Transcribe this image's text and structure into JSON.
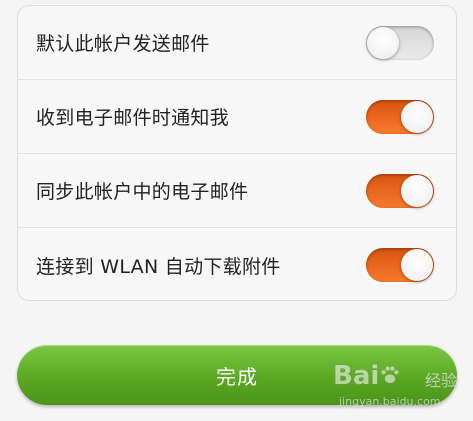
{
  "settings": [
    {
      "label": "默认此帐户发送邮件",
      "enabled": false
    },
    {
      "label": "收到电子邮件时通知我",
      "enabled": true
    },
    {
      "label": "同步此帐户中的电子邮件",
      "enabled": true
    },
    {
      "label": "连接到 WLAN 自动下载附件",
      "enabled": true
    }
  ],
  "done_button": {
    "label": "完成"
  },
  "colors": {
    "toggle_on": "#f26b1d",
    "toggle_off": "#dcdcdc",
    "done_button": "#5ba823"
  },
  "watermark": {
    "brand_prefix": "Bai",
    "brand_suffix": "经验",
    "url": "jingyan.baidu.com"
  }
}
